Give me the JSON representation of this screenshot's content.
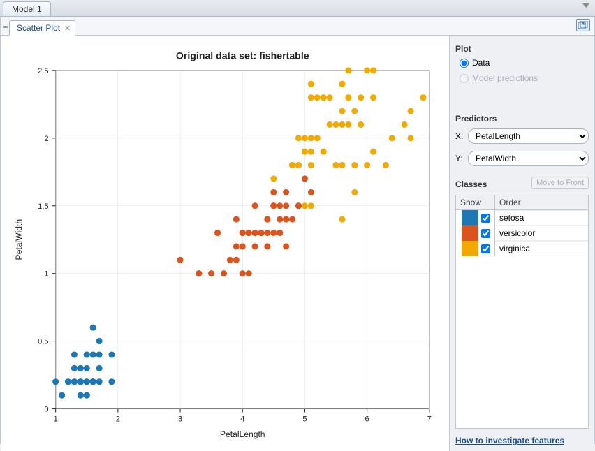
{
  "outer_tab": "Model 1",
  "inner_tab": "Scatter Plot",
  "side": {
    "plot_heading": "Plot",
    "radio_data": "Data",
    "radio_model": "Model predictions",
    "predictors_heading": "Predictors",
    "x_label": "X:",
    "y_label": "Y:",
    "x_value": "PetalLength",
    "y_value": "PetalWidth",
    "classes_heading": "Classes",
    "move_btn": "Move to Front",
    "col_show": "Show",
    "col_order": "Order",
    "help_link": "How to investigate features"
  },
  "classes": [
    {
      "name": "setosa",
      "color": "#1f77b4"
    },
    {
      "name": "versicolor",
      "color": "#d9541e"
    },
    {
      "name": "virginica",
      "color": "#f2a900"
    }
  ],
  "chart_data": {
    "type": "scatter",
    "title": "Original data set: fishertable",
    "xlabel": "PetalLength",
    "ylabel": "PetalWidth",
    "xlim": [
      1,
      7
    ],
    "ylim": [
      0,
      2.5
    ],
    "xticks": [
      1,
      2,
      3,
      4,
      5,
      6,
      7
    ],
    "yticks": [
      0,
      0.5,
      1,
      1.5,
      2,
      2.5
    ],
    "series": [
      {
        "name": "setosa",
        "color": "#1f77b4",
        "points": [
          [
            1.4,
            0.2
          ],
          [
            1.4,
            0.2
          ],
          [
            1.3,
            0.2
          ],
          [
            1.5,
            0.2
          ],
          [
            1.4,
            0.2
          ],
          [
            1.7,
            0.4
          ],
          [
            1.4,
            0.3
          ],
          [
            1.5,
            0.2
          ],
          [
            1.4,
            0.2
          ],
          [
            1.5,
            0.1
          ],
          [
            1.5,
            0.2
          ],
          [
            1.6,
            0.2
          ],
          [
            1.4,
            0.1
          ],
          [
            1.1,
            0.1
          ],
          [
            1.2,
            0.2
          ],
          [
            1.5,
            0.4
          ],
          [
            1.3,
            0.4
          ],
          [
            1.4,
            0.3
          ],
          [
            1.7,
            0.3
          ],
          [
            1.5,
            0.3
          ],
          [
            1.7,
            0.2
          ],
          [
            1.5,
            0.4
          ],
          [
            1.0,
            0.2
          ],
          [
            1.7,
            0.5
          ],
          [
            1.9,
            0.2
          ],
          [
            1.6,
            0.2
          ],
          [
            1.6,
            0.4
          ],
          [
            1.5,
            0.2
          ],
          [
            1.4,
            0.2
          ],
          [
            1.6,
            0.2
          ],
          [
            1.6,
            0.2
          ],
          [
            1.5,
            0.4
          ],
          [
            1.5,
            0.1
          ],
          [
            1.4,
            0.2
          ],
          [
            1.5,
            0.2
          ],
          [
            1.2,
            0.2
          ],
          [
            1.3,
            0.2
          ],
          [
            1.4,
            0.1
          ],
          [
            1.3,
            0.2
          ],
          [
            1.5,
            0.2
          ],
          [
            1.3,
            0.3
          ],
          [
            1.3,
            0.3
          ],
          [
            1.3,
            0.2
          ],
          [
            1.6,
            0.6
          ],
          [
            1.9,
            0.4
          ],
          [
            1.4,
            0.3
          ],
          [
            1.6,
            0.2
          ],
          [
            1.4,
            0.2
          ],
          [
            1.5,
            0.2
          ],
          [
            1.4,
            0.2
          ]
        ]
      },
      {
        "name": "versicolor",
        "color": "#d9541e",
        "points": [
          [
            4.7,
            1.4
          ],
          [
            4.5,
            1.5
          ],
          [
            4.9,
            1.5
          ],
          [
            4.0,
            1.3
          ],
          [
            4.6,
            1.5
          ],
          [
            4.5,
            1.3
          ],
          [
            4.7,
            1.6
          ],
          [
            3.3,
            1.0
          ],
          [
            4.6,
            1.3
          ],
          [
            3.9,
            1.4
          ],
          [
            3.5,
            1.0
          ],
          [
            4.2,
            1.5
          ],
          [
            4.0,
            1.0
          ],
          [
            4.7,
            1.4
          ],
          [
            3.6,
            1.3
          ],
          [
            4.4,
            1.4
          ],
          [
            4.5,
            1.5
          ],
          [
            4.1,
            1.0
          ],
          [
            4.5,
            1.5
          ],
          [
            3.9,
            1.1
          ],
          [
            4.8,
            1.8
          ],
          [
            4.0,
            1.3
          ],
          [
            4.9,
            1.5
          ],
          [
            4.7,
            1.2
          ],
          [
            4.3,
            1.3
          ],
          [
            4.4,
            1.4
          ],
          [
            4.8,
            1.4
          ],
          [
            5.0,
            1.7
          ],
          [
            4.5,
            1.5
          ],
          [
            3.5,
            1.0
          ],
          [
            3.8,
            1.1
          ],
          [
            3.7,
            1.0
          ],
          [
            3.9,
            1.2
          ],
          [
            5.1,
            1.6
          ],
          [
            4.5,
            1.5
          ],
          [
            4.5,
            1.6
          ],
          [
            4.7,
            1.5
          ],
          [
            4.4,
            1.3
          ],
          [
            4.1,
            1.3
          ],
          [
            4.0,
            1.3
          ],
          [
            4.4,
            1.2
          ],
          [
            4.6,
            1.4
          ],
          [
            4.0,
            1.2
          ],
          [
            3.3,
            1.0
          ],
          [
            4.2,
            1.3
          ],
          [
            4.2,
            1.2
          ],
          [
            4.2,
            1.3
          ],
          [
            4.3,
            1.3
          ],
          [
            3.0,
            1.1
          ],
          [
            4.1,
            1.3
          ]
        ]
      },
      {
        "name": "virginica",
        "color": "#f2a900",
        "points": [
          [
            6.0,
            2.5
          ],
          [
            5.1,
            1.9
          ],
          [
            5.9,
            2.1
          ],
          [
            5.6,
            1.8
          ],
          [
            5.8,
            2.2
          ],
          [
            6.6,
            2.1
          ],
          [
            4.5,
            1.7
          ],
          [
            6.3,
            1.8
          ],
          [
            5.8,
            1.8
          ],
          [
            6.1,
            2.5
          ],
          [
            5.1,
            2.0
          ],
          [
            5.3,
            1.9
          ],
          [
            5.5,
            2.1
          ],
          [
            5.0,
            2.0
          ],
          [
            5.1,
            2.4
          ],
          [
            5.3,
            2.3
          ],
          [
            5.5,
            1.8
          ],
          [
            6.7,
            2.2
          ],
          [
            6.9,
            2.3
          ],
          [
            5.0,
            1.5
          ],
          [
            5.7,
            2.3
          ],
          [
            4.9,
            2.0
          ],
          [
            6.7,
            2.0
          ],
          [
            4.9,
            1.8
          ],
          [
            5.7,
            2.1
          ],
          [
            6.0,
            1.8
          ],
          [
            4.8,
            1.8
          ],
          [
            4.9,
            1.8
          ],
          [
            5.6,
            2.1
          ],
          [
            5.8,
            1.6
          ],
          [
            6.1,
            1.9
          ],
          [
            6.4,
            2.0
          ],
          [
            5.6,
            2.2
          ],
          [
            5.1,
            1.5
          ],
          [
            5.6,
            1.4
          ],
          [
            6.1,
            2.3
          ],
          [
            5.6,
            2.4
          ],
          [
            5.5,
            1.8
          ],
          [
            4.8,
            1.8
          ],
          [
            5.4,
            2.1
          ],
          [
            5.6,
            2.4
          ],
          [
            5.1,
            2.3
          ],
          [
            5.1,
            1.9
          ],
          [
            5.9,
            2.3
          ],
          [
            5.7,
            2.5
          ],
          [
            5.2,
            2.3
          ],
          [
            5.0,
            1.9
          ],
          [
            5.2,
            2.0
          ],
          [
            5.4,
            2.3
          ],
          [
            5.1,
            1.8
          ]
        ]
      }
    ]
  }
}
